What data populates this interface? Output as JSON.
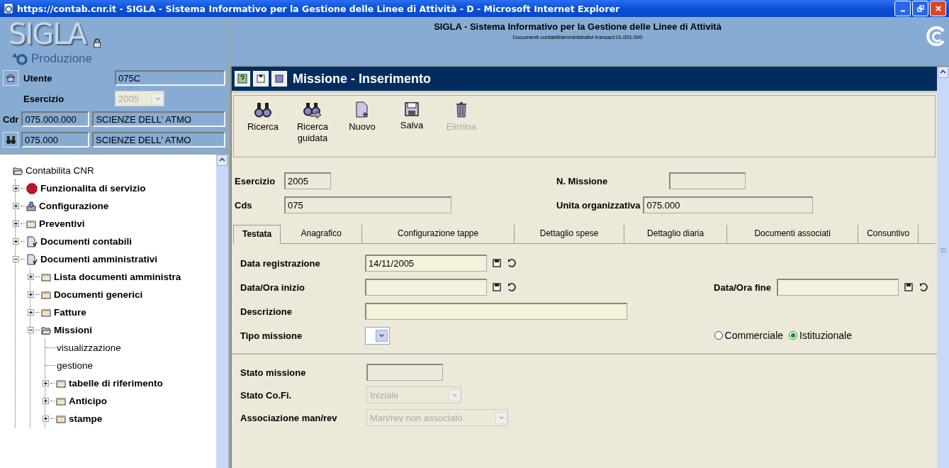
{
  "window": {
    "title": "https://contab.cnr.it - SIGLA - Sistema Informativo per la Gestione delle Linee di Attività - D - Microsoft Internet Explorer"
  },
  "header": {
    "title": "SIGLA - Sistema Informativo per la Gestione delle Linee di Attività",
    "subtitle": "Documenti contabili/amministrativi transact.01.001.000"
  },
  "sidebar": {
    "logo": "SIGLA",
    "environment": "Produzione",
    "utente": {
      "label": "Utente",
      "value": "075C"
    },
    "esercizio": {
      "label": "Esercizio",
      "value": "2005",
      "disabled": true
    },
    "cdr": {
      "label": "Cdr",
      "code": "075.000.000",
      "name": "SCIENZE DELL' ATMO"
    },
    "uo": {
      "code": "075.000",
      "name": "SCIENZE DELL' ATMO"
    },
    "tree": {
      "label": "Contabilita CNR",
      "kind": "folder",
      "expanded": true,
      "children": [
        {
          "label": "Funzionalita di servizio",
          "kind": "stop",
          "expanded": false
        },
        {
          "label": "Configurazione",
          "kind": "install",
          "expanded": false
        },
        {
          "label": "Preventivi",
          "kind": "folder",
          "expanded": false
        },
        {
          "label": "Documenti contabili",
          "kind": "document",
          "expanded": false
        },
        {
          "label": "Documenti amministrativi",
          "kind": "document",
          "expanded": true,
          "children": [
            {
              "label": "Lista documenti amministra",
              "kind": "folder",
              "expanded": false
            },
            {
              "label": "Documenti generici",
              "kind": "folder",
              "expanded": false
            },
            {
              "label": "Fatture",
              "kind": "folder",
              "expanded": false
            },
            {
              "label": "Missioni",
              "kind": "folder",
              "expanded": true,
              "children": [
                {
                  "label": "visualizzazione",
                  "kind": "leaf"
                },
                {
                  "label": "gestione",
                  "kind": "leaf"
                },
                {
                  "label": "tabelle di riferimento",
                  "kind": "folder",
                  "expanded": false
                },
                {
                  "label": "Anticipo",
                  "kind": "folder",
                  "expanded": false
                },
                {
                  "label": "stampe",
                  "kind": "folder",
                  "expanded": false
                }
              ]
            }
          ]
        }
      ]
    }
  },
  "panel": {
    "title": "Missione - Inserimento",
    "toolbar": [
      {
        "label": "Ricerca",
        "kind": "search",
        "disabled": false
      },
      {
        "label": "Ricerca guidata",
        "kind": "guided-search",
        "disabled": false
      },
      {
        "label": "Nuovo",
        "kind": "new",
        "disabled": false
      },
      {
        "label": "Salva",
        "kind": "save",
        "disabled": false
      },
      {
        "label": "Elimina",
        "kind": "delete",
        "disabled": true
      }
    ],
    "esercizio": {
      "label": "Esercizio",
      "value": "2005"
    },
    "n_missione": {
      "label": "N. Missione"
    },
    "cds": {
      "label": "Cds",
      "value": "075"
    },
    "unita": {
      "label": "Unita organizzativa",
      "value": "075.000"
    },
    "tabs": [
      {
        "label": "Testata",
        "selected": true
      },
      {
        "label": "Anagrafico",
        "selected": false
      },
      {
        "label": "Configurazione tappe",
        "selected": false
      },
      {
        "label": "Dettaglio spese",
        "selected": false
      },
      {
        "label": "Dettaglio diaria",
        "selected": false
      },
      {
        "label": "Documenti associati",
        "selected": false
      },
      {
        "label": "Consuntivo",
        "selected": false
      }
    ],
    "data_registrazione": {
      "label": "Data registrazione",
      "value": "14/11/2005"
    },
    "data_inizio": {
      "label": "Data/Ora inizio"
    },
    "data_fine": {
      "label": "Data/Ora fine"
    },
    "descrizione": {
      "label": "Descrizione"
    },
    "tipo_missione": {
      "label": "Tipo missione"
    },
    "tipo_radio": [
      {
        "label": "Commerciale",
        "selected": false
      },
      {
        "label": "Istituzionale",
        "selected": true
      }
    ],
    "stato_missione": {
      "label": "Stato missione"
    },
    "stato_cofi": {
      "label": "Stato Co.Fi.",
      "value": "Iniziale",
      "disabled": true
    },
    "associazione": {
      "label": "Associazione man/rev",
      "value": "Man/rev non associato",
      "disabled": true
    }
  }
}
